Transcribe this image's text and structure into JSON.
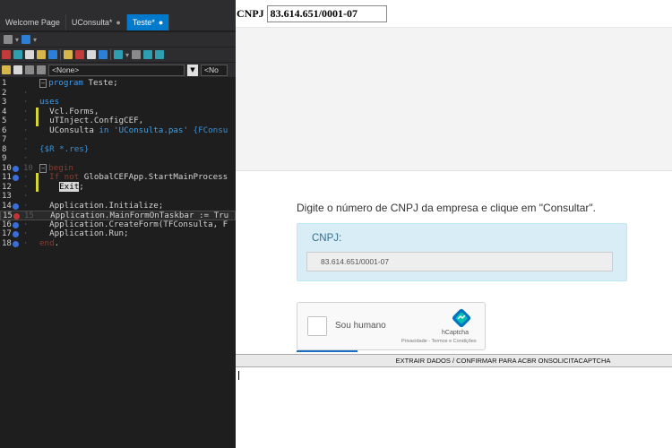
{
  "ide": {
    "tabs": [
      {
        "label": "Welcome Page",
        "modified": ""
      },
      {
        "label": "UConsulta*",
        "modified": "●"
      },
      {
        "label": "Teste*",
        "modified": "●"
      }
    ],
    "combo_none_1": "<None>",
    "combo_none_2": "<No",
    "lines": [
      {
        "n": "1",
        "gutter": "",
        "bp": "",
        "parts": [
          {
            "t": "program",
            "c": "kw"
          },
          {
            "t": " Teste;",
            "c": ""
          }
        ],
        "fold": true
      },
      {
        "n": "2",
        "gutter": "·",
        "bp": "",
        "parts": [],
        "fold": false
      },
      {
        "n": "3",
        "gutter": "·",
        "bp": "",
        "parts": [
          {
            "t": "uses",
            "c": "kw"
          }
        ],
        "fold": false
      },
      {
        "n": "4",
        "gutter": "·",
        "bp": "",
        "parts": [
          {
            "t": "  Vcl.Forms,",
            "c": ""
          }
        ],
        "fold": false,
        "chg": true
      },
      {
        "n": "5",
        "gutter": "·",
        "bp": "",
        "parts": [
          {
            "t": "  uTInject.ConfigCEF,",
            "c": ""
          }
        ],
        "fold": false,
        "chg": true
      },
      {
        "n": "6",
        "gutter": "·",
        "bp": "",
        "parts": [
          {
            "t": "  UConsulta ",
            "c": ""
          },
          {
            "t": "in",
            "c": "kw"
          },
          {
            "t": " ",
            "c": ""
          },
          {
            "t": "'UConsulta.pas'",
            "c": "str"
          },
          {
            "t": " {FConsu",
            "c": "cmt"
          }
        ],
        "fold": false
      },
      {
        "n": "7",
        "gutter": "·",
        "bp": "",
        "parts": [],
        "fold": false
      },
      {
        "n": "8",
        "gutter": "·",
        "bp": "",
        "parts": [
          {
            "t": "{$R *.res}",
            "c": "cmt"
          }
        ],
        "fold": false
      },
      {
        "n": "9",
        "gutter": "·",
        "bp": "",
        "parts": [],
        "fold": false
      },
      {
        "n": "10",
        "gutter": "10",
        "bp": "blue",
        "parts": [
          {
            "t": "begin",
            "c": "dead"
          }
        ],
        "fold": true
      },
      {
        "n": "11",
        "gutter": "·",
        "bp": "blue",
        "parts": [
          {
            "t": "  If not",
            "c": "dead"
          },
          {
            "t": " GlobalCEFApp.StartMainProcess",
            "c": ""
          }
        ],
        "fold": false,
        "chg": true
      },
      {
        "n": "12",
        "gutter": "·",
        "bp": "",
        "parts": [
          {
            "t": "    ",
            "c": ""
          },
          {
            "t": "Exit",
            "c": "hl"
          },
          {
            "t": ";",
            "c": ""
          }
        ],
        "fold": false,
        "chg": true
      },
      {
        "n": "13",
        "gutter": "·",
        "bp": "",
        "parts": [],
        "fold": false
      },
      {
        "n": "14",
        "gutter": "·",
        "bp": "blue",
        "parts": [
          {
            "t": "  Application.Initialize;",
            "c": ""
          }
        ],
        "fold": false
      },
      {
        "n": "15",
        "gutter": "15",
        "bp": "red",
        "parts": [
          {
            "t": "  Application.MainFormOnTaskbar := Tru",
            "c": ""
          }
        ],
        "fold": false,
        "cur": true
      },
      {
        "n": "16",
        "gutter": "·",
        "bp": "blue",
        "parts": [
          {
            "t": "  Application.CreateForm(TFConsulta, F",
            "c": ""
          }
        ],
        "fold": false
      },
      {
        "n": "17",
        "gutter": "·",
        "bp": "blue",
        "parts": [
          {
            "t": "  Application.Run;",
            "c": ""
          }
        ],
        "fold": false
      },
      {
        "n": "18",
        "gutter": "·",
        "bp": "blue",
        "parts": [
          {
            "t": "end",
            "c": "dead"
          },
          {
            "t": ".",
            "c": ""
          }
        ],
        "fold": false
      }
    ]
  },
  "app": {
    "top_label": "CNPJ",
    "top_value": "83.614.651/0001-07",
    "instructions": "Digite o número de CNPJ da empresa e clique em \"Consultar\".",
    "card_label": "CNPJ:",
    "card_value": "83.614.651/0001-07",
    "captcha_text": "Sou humano",
    "captcha_brand": "hCaptcha",
    "captcha_privacy": "Privacidade - Termos e Condições",
    "bottom_button": "EXTRAIR DADOS / CONFIRMAR PARA ACBR ONSOLICITACAPTCHA"
  },
  "colors": {
    "ide_bg": "#1e1e1e",
    "tab_active": "#007acc",
    "card_bg": "#d9edf7",
    "card_label": "#31708f",
    "captcha_accent": "#1a6fc5"
  }
}
